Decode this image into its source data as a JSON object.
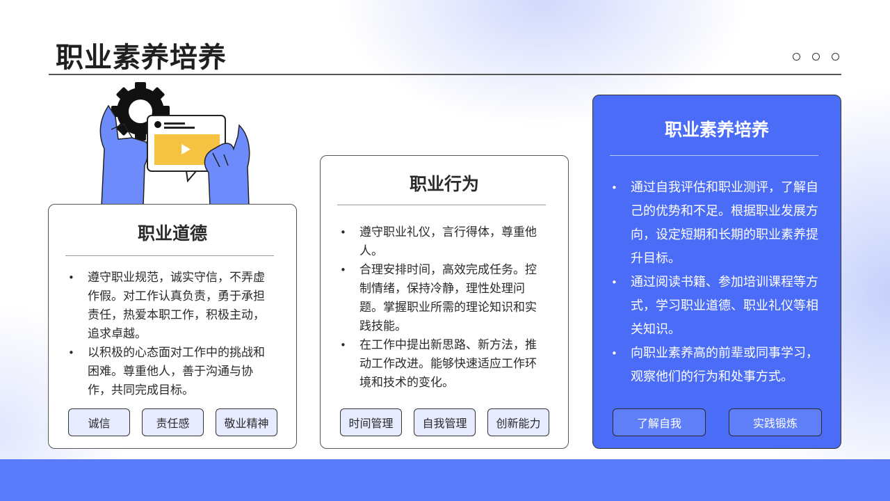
{
  "page": {
    "title": "职业素养培养"
  },
  "colors": {
    "accent": "#4a6cf7",
    "band": "#5b7cfa",
    "tag_bg": "#e6ebff"
  },
  "cards": [
    {
      "heading": "职业道德",
      "bullets": [
        "遵守职业规范，诚实守信，不弄虚作假。对工作认真负责，勇于承担责任，热爱本职工作，积极主动，追求卓越。",
        "以积极的心态面对工作中的挑战和困难。尊重他人，善于沟通与协作，共同完成目标。"
      ],
      "tags": [
        "诚信",
        "责任感",
        "敬业精神"
      ]
    },
    {
      "heading": "职业行为",
      "bullets": [
        "遵守职业礼仪，言行得体，尊重他人。",
        "合理安排时间，高效完成任务。控制情绪，保持冷静，理性处理问题。掌握职业所需的理论知识和实践技能。",
        "在工作中提出新思路、新方法，推动工作改进。能够快速适应工作环境和技术的变化。"
      ],
      "tags": [
        "时间管理",
        "自我管理",
        "创新能力"
      ]
    },
    {
      "heading": "职业素养培养",
      "bullets": [
        "通过自我评估和职业测评，了解自己的优势和不足。根据职业发展方向，设定短期和长期的职业素养提升目标。",
        "通过阅读书籍、参加培训课程等方式，学习职业道德、职业礼仪等相关知识。",
        "向职业素养高的前辈或同事学习，观察他们的行为和处事方式。"
      ],
      "tags": [
        "了解自我",
        "实践锻炼"
      ]
    }
  ],
  "icons": [
    "gear-icon",
    "video-play-icon",
    "window-dots-icon"
  ]
}
